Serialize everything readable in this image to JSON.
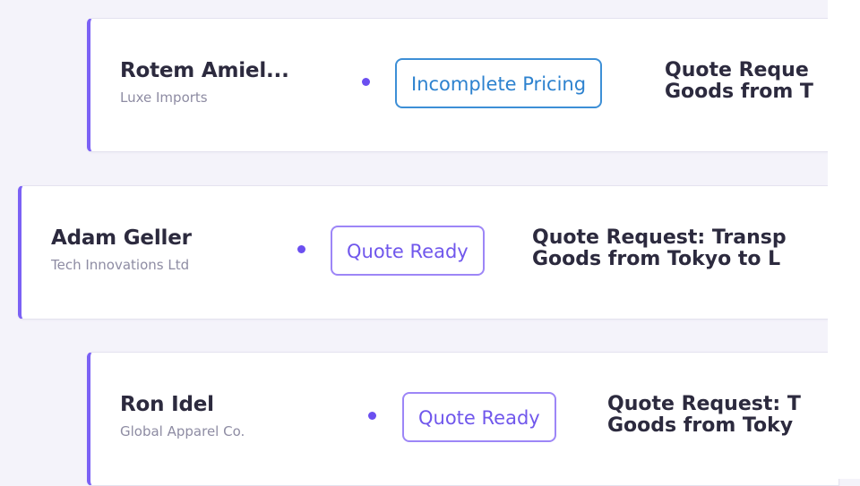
{
  "colors": {
    "accent": "#7b61f5",
    "dot": "#6b4ff0",
    "badge_incomplete": "#2d82cf",
    "badge_ready": "#7057ec"
  },
  "quotes": [
    {
      "contact_name": "Rotem Amiel...",
      "company": "Luxe Imports",
      "status": "Incomplete Pricing",
      "subject_line1": "Quote Reque",
      "subject_line2": "Goods from T"
    },
    {
      "contact_name": "Adam Geller",
      "company": "Tech Innovations Ltd",
      "status": "Quote Ready",
      "subject_line1": "Quote Request: Transp",
      "subject_line2": "Goods from Tokyo to L"
    },
    {
      "contact_name": "Ron Idel",
      "company": "Global Apparel Co.",
      "status": "Quote Ready",
      "subject_line1": "Quote Request: T",
      "subject_line2": "Goods from Toky"
    }
  ]
}
